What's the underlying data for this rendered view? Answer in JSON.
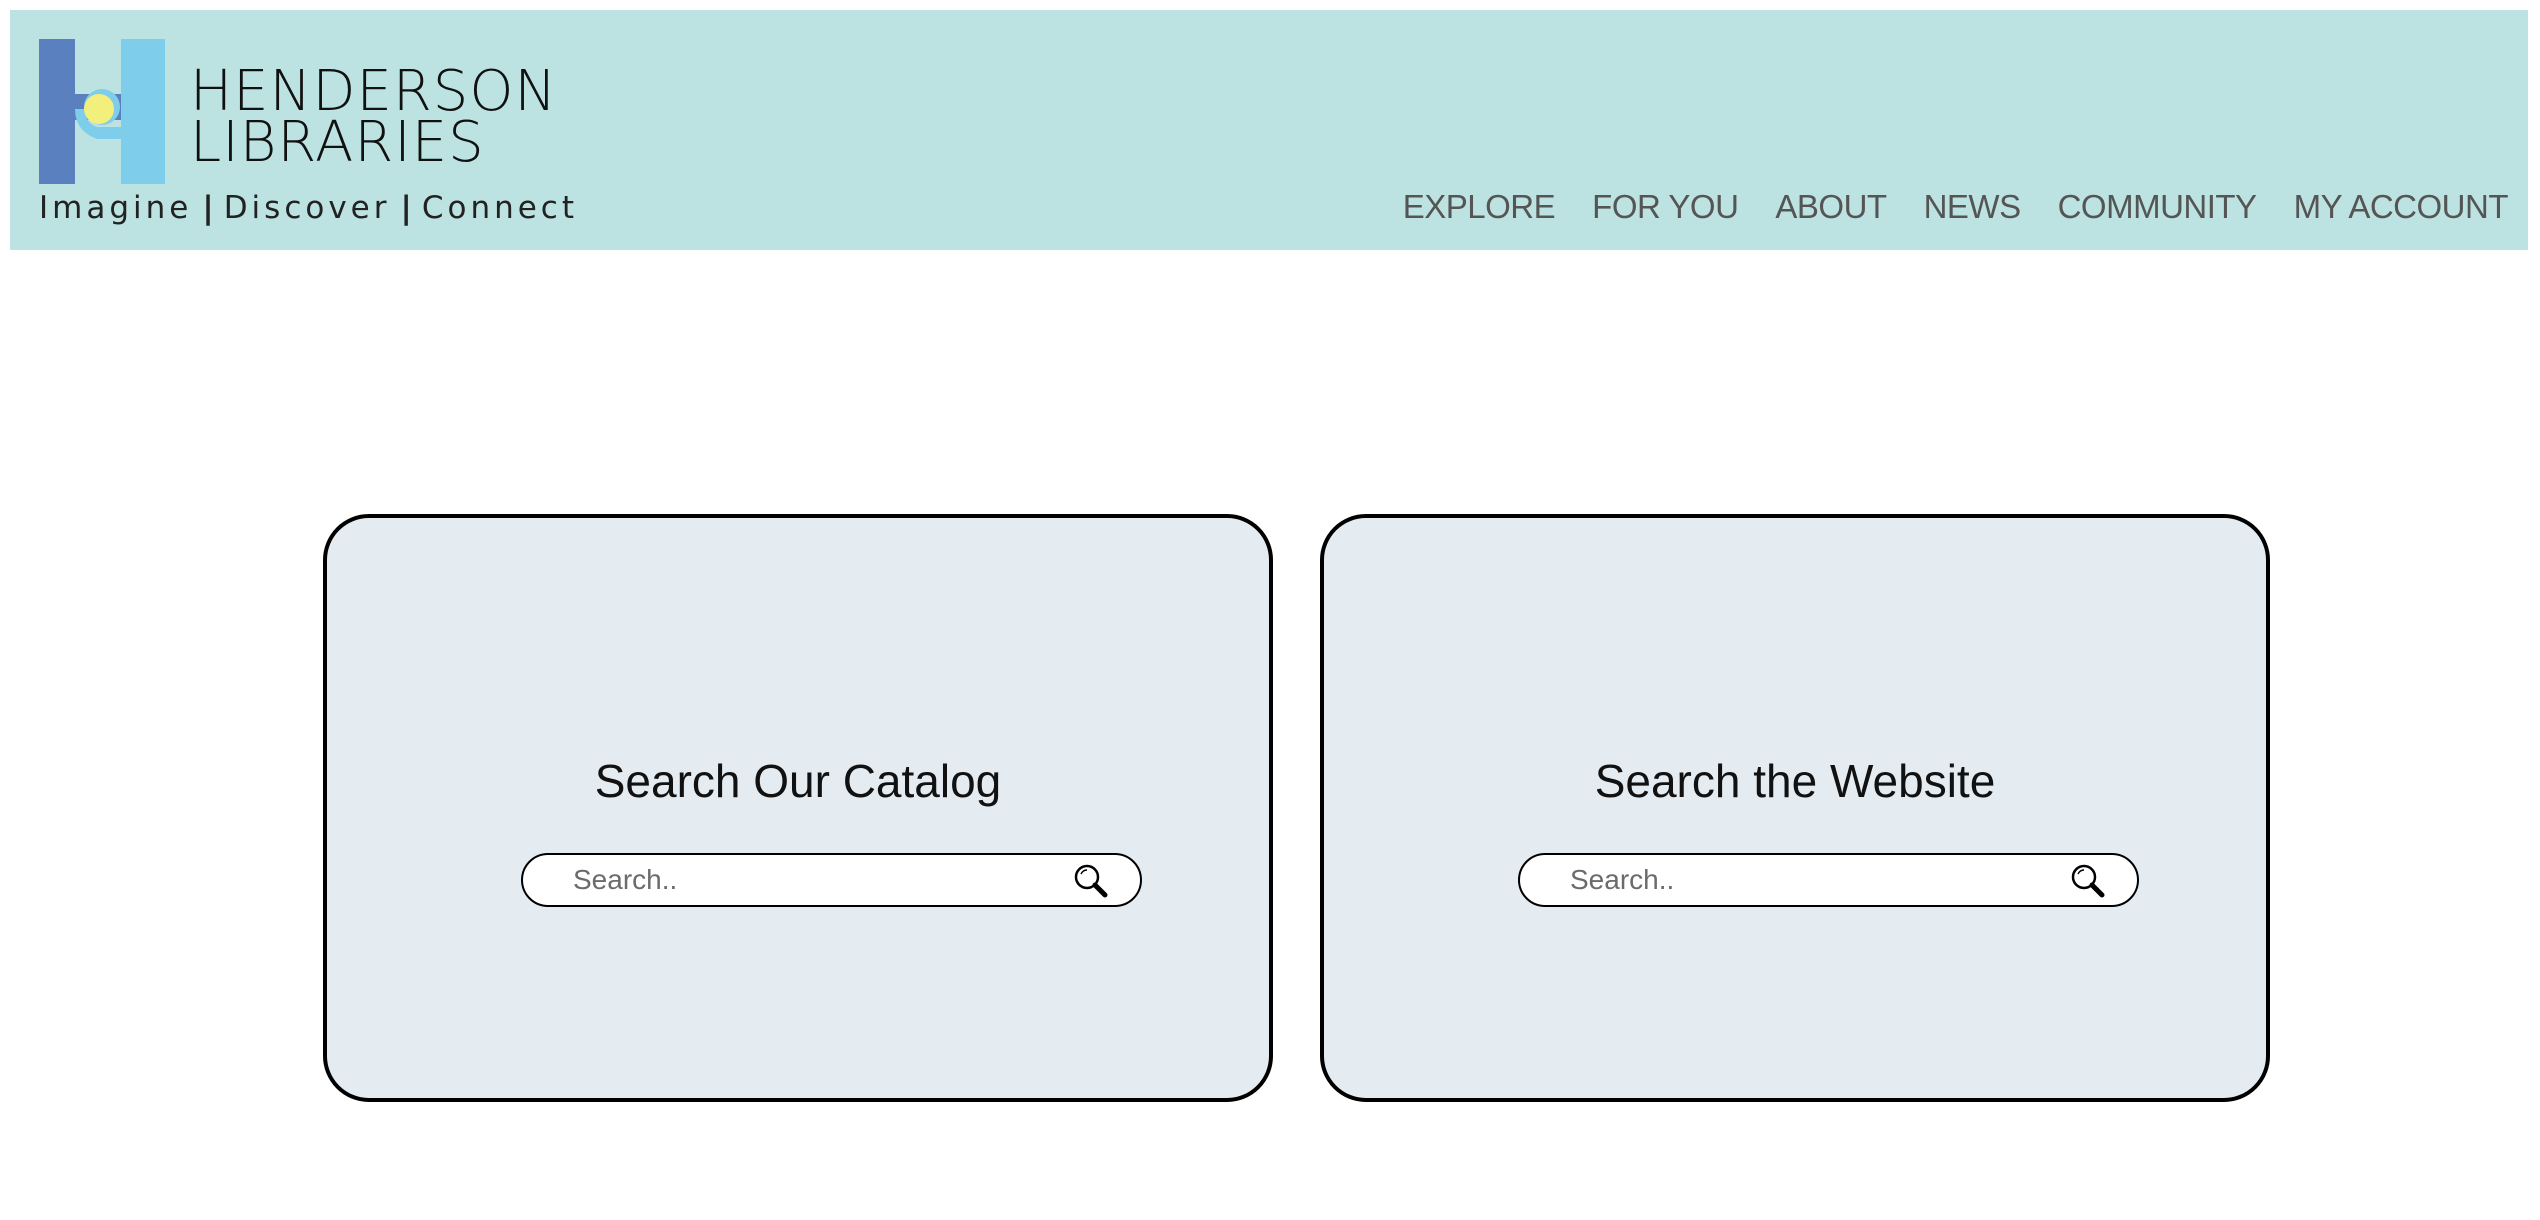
{
  "header": {
    "brand_line_1": "HENDERSON",
    "brand_line_2": "LIBRARIES",
    "tagline": [
      "Imagine",
      "Discover",
      "Connect"
    ],
    "tagline_separator": "|",
    "logo_icon": "henderson-h-logo"
  },
  "nav": {
    "items": [
      "EXPLORE",
      "FOR YOU",
      "ABOUT",
      "NEWS",
      "COMMUNITY",
      "MY ACCOUNT"
    ]
  },
  "cards": [
    {
      "title": "Search Our Catalog",
      "search_placeholder": "Search..",
      "search_icon": "search-icon"
    },
    {
      "title": "Search the Website",
      "search_placeholder": "Search..",
      "search_icon": "search-icon"
    }
  ],
  "colors": {
    "header_bg": "#bce3e2",
    "card_bg": "#e5ecf1",
    "logo_dark_blue": "#5b80c0",
    "logo_light_blue": "#7dcdeb",
    "logo_yellow": "#f3ef7c"
  }
}
